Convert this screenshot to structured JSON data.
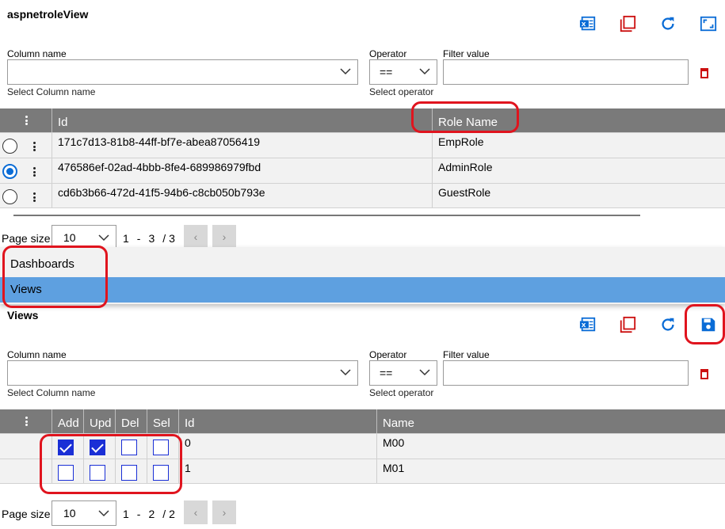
{
  "top": {
    "title": "aspnetroleView",
    "filter": {
      "column_label": "Column name",
      "column_hint": "Select Column name",
      "operator_label": "Operator",
      "operator_value": "==",
      "operator_hint": "Select operator",
      "value_label": "Filter value"
    },
    "grid": {
      "headers": [
        "Id",
        "Role Name"
      ],
      "rows": [
        {
          "id": "171c7d13-81b8-44ff-bf7e-abea87056419",
          "name": "EmpRole",
          "selected": false
        },
        {
          "id": "476586ef-02ad-4bbb-8fe4-689986979fbd",
          "name": "AdminRole",
          "selected": true
        },
        {
          "id": "cd6b3b66-472d-41f5-94b6-c8cb050b793e",
          "name": "GuestRole",
          "selected": false
        }
      ]
    },
    "pager": {
      "label": "Page size",
      "size": "10",
      "range_start": "1",
      "range_end": "3",
      "total": "3",
      "dash": "-",
      "slash": "/"
    }
  },
  "menu": {
    "items": [
      {
        "label": "Dashboards",
        "active": false
      },
      {
        "label": "Views",
        "active": true
      }
    ]
  },
  "bottom": {
    "title": "Views",
    "filter": {
      "column_label": "Column name",
      "column_hint": "Select Column name",
      "operator_label": "Operator",
      "operator_value": "==",
      "operator_hint": "Select operator",
      "value_label": "Filter value"
    },
    "grid": {
      "headers": [
        "Add",
        "Upd",
        "Del",
        "Sel",
        "Id",
        "Name"
      ],
      "rows": [
        {
          "add": true,
          "upd": true,
          "del": false,
          "sel": false,
          "id": "0",
          "name": "M00"
        },
        {
          "add": false,
          "upd": false,
          "del": false,
          "sel": false,
          "id": "1",
          "name": "M01"
        }
      ]
    },
    "pager": {
      "label": "Page size",
      "size": "10",
      "range_start": "1",
      "range_end": "2",
      "total": "2",
      "dash": "-",
      "slash": "/"
    }
  },
  "icons": {
    "excel": "excel-export-icon",
    "copy": "copy-icon",
    "refresh": "refresh-icon",
    "expand": "expand-icon",
    "save": "save-icon",
    "delete": "delete-icon",
    "chevron": "chevron-down-icon",
    "prev": "chevron-left-icon",
    "next": "chevron-right-icon",
    "prev_glyph": "‹",
    "next_glyph": "›"
  },
  "colors": {
    "accent": "#0a6cd6",
    "danger": "#cc1010",
    "header": "#7a7a7a",
    "menu_active": "#5ea0e0",
    "checkbox": "#1a2fd6"
  }
}
